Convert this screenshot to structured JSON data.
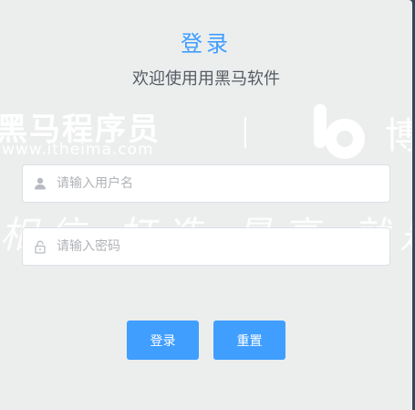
{
  "header": {
    "title": "登录",
    "subtitle": "欢迎使用用黑马软件"
  },
  "watermark": {
    "brand": "黑马程序员",
    "url": "www.itheima.com",
    "right_char": "博",
    "script": "相信  打造 最高 就是"
  },
  "form": {
    "username": {
      "value": "",
      "placeholder": "请输入用户名",
      "icon": "user-icon"
    },
    "password": {
      "value": "",
      "placeholder": "请输入密码",
      "icon": "lock-icon"
    }
  },
  "buttons": {
    "login_label": "登录",
    "reset_label": "重置"
  },
  "colors": {
    "accent": "#409eff",
    "card_bg": "#eceeee",
    "page_bg": "#3a4d63"
  }
}
